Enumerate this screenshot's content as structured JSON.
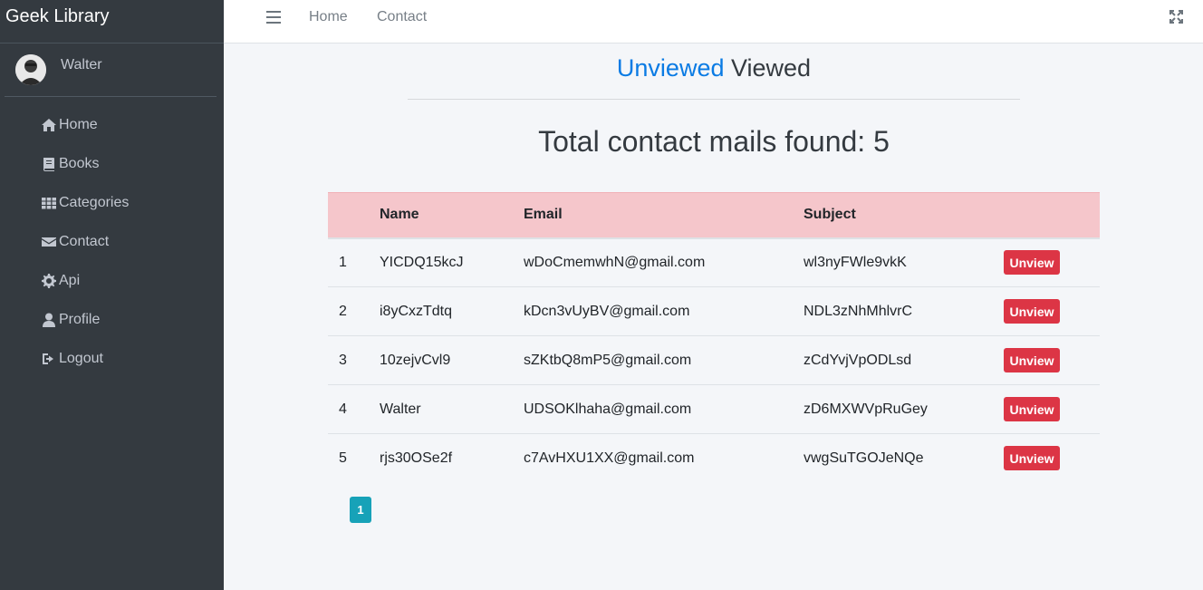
{
  "brand": {
    "title": "Geek Library"
  },
  "user": {
    "name": "Walter"
  },
  "sidebar": {
    "items": [
      {
        "label": "Home",
        "icon": "home-icon"
      },
      {
        "label": "Books",
        "icon": "book-icon"
      },
      {
        "label": "Categories",
        "icon": "grid-icon"
      },
      {
        "label": "Contact",
        "icon": "envelope-icon"
      },
      {
        "label": "Api",
        "icon": "gear-icon"
      },
      {
        "label": "Profile",
        "icon": "user-icon"
      },
      {
        "label": "Logout",
        "icon": "sign-out-icon"
      }
    ]
  },
  "topnav": {
    "links": [
      "Home",
      "Contact"
    ]
  },
  "tabs": {
    "unviewed": "Unviewed",
    "viewed": "Viewed",
    "active": "Unviewed"
  },
  "title": "Total contact mails found: 5",
  "table": {
    "headers": [
      "",
      "Name",
      "Email",
      "Subject",
      ""
    ],
    "rows": [
      {
        "num": "1",
        "name": "YICDQ15kcJ",
        "email": "wDoCmemwhN@gmail.com",
        "subject": "wl3nyFWle9vkK",
        "action": "Unview"
      },
      {
        "num": "2",
        "name": "i8yCxzTdtq",
        "email": "kDcn3vUyBV@gmail.com",
        "subject": "NDL3zNhMhlvrC",
        "action": "Unview"
      },
      {
        "num": "3",
        "name": "10zejvCvl9",
        "email": "sZKtbQ8mP5@gmail.com",
        "subject": "zCdYvjVpODLsd",
        "action": "Unview"
      },
      {
        "num": "4",
        "name": "Walter",
        "email": "UDSOKlhaha@gmail.com",
        "subject": "zD6MXWVpRuGey",
        "action": "Unview"
      },
      {
        "num": "5",
        "name": "rjs30OSe2f",
        "email": "c7AvHXU1XX@gmail.com",
        "subject": "vwgSuTGOJeNQe",
        "action": "Unview"
      }
    ]
  },
  "pagination": {
    "current": "1"
  },
  "colors": {
    "sidebar_bg": "#343a40",
    "accent_blue": "#0a7be4",
    "danger": "#dc3545",
    "info": "#17a2b8",
    "table_head_bg": "#f5c6cb"
  }
}
